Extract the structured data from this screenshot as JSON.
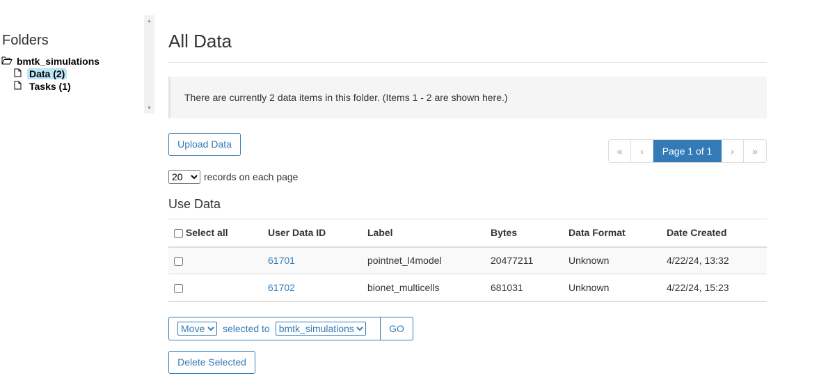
{
  "sidebar": {
    "title": "Folders",
    "root": {
      "label": "bmtk_simulations",
      "icon": "folder-open-icon"
    },
    "items": [
      {
        "label": "Data (2)",
        "icon": "file-icon",
        "selected": true
      },
      {
        "label": "Tasks (1)",
        "icon": "file-icon",
        "selected": false
      }
    ]
  },
  "main": {
    "title": "All Data",
    "info": "There are currently 2 data items in this folder. (Items 1 - 2 are shown here.)",
    "upload_label": "Upload Data",
    "pagination": {
      "first": "«",
      "prev": "‹",
      "current": "Page 1 of 1",
      "next": "›",
      "last": "»"
    },
    "records": {
      "selected": "20",
      "suffix": "records on each page"
    },
    "section_title": "Use Data",
    "table": {
      "headers": [
        "Select all",
        "User Data ID",
        "Label",
        "Bytes",
        "Data Format",
        "Date Created"
      ],
      "rows": [
        {
          "id": "61701",
          "label": "pointnet_l4model",
          "bytes": "20477211",
          "format": "Unknown",
          "date": "4/22/24, 13:32"
        },
        {
          "id": "61702",
          "label": "bionet_multicells",
          "bytes": "681031",
          "format": "Unknown",
          "date": "4/22/24, 15:23"
        }
      ]
    },
    "action": {
      "operation": "Move",
      "middle_text": "selected to",
      "target": "bmtk_simulations",
      "go_label": "GO"
    },
    "delete_label": "Delete Selected"
  },
  "colors": {
    "link": "#337ab7",
    "selected_bg": "#bde4f7",
    "active_page": "#337ab7"
  }
}
